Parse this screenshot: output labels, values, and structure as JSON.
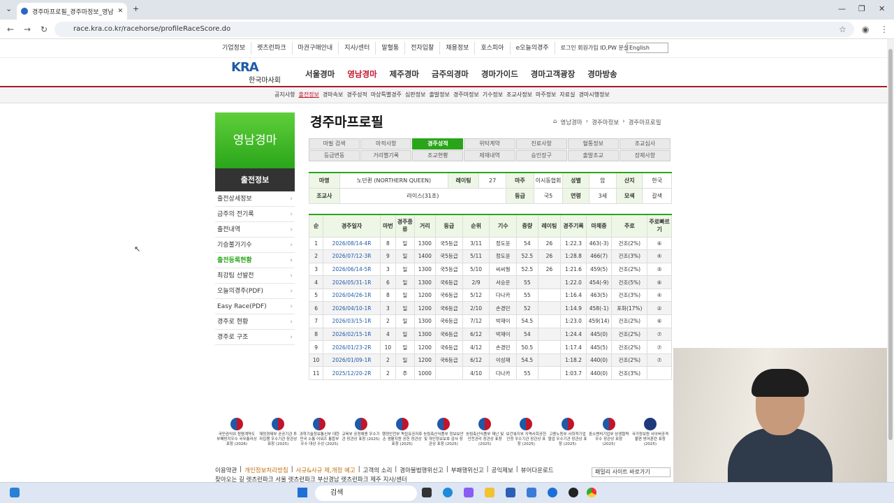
{
  "browser": {
    "tab_title": "경주마프로필_경주마정보_영남",
    "url": "race.kra.co.kr/racehorse/profileRaceScore.do"
  },
  "util_menu": [
    "기업정보",
    "렛츠런파크",
    "마권구매안내",
    "지사/센터",
    "말혈통",
    "전자입찰",
    "채용정보",
    "호스피아",
    "e오늘의경주",
    "로그인 회원가입 ID,PW 분실"
  ],
  "language": "English",
  "logo": {
    "mark": "KRA",
    "name": "한국마사회"
  },
  "gnb": [
    "서울경마",
    "영남경마",
    "제주경마",
    "금주의경마",
    "경마가이드",
    "경마고객광장",
    "경마방송"
  ],
  "subnav": [
    "공지사항",
    "출전정보",
    "경마속보",
    "경주성적",
    "마상특별경주",
    "심판정보",
    "출발정보",
    "경주마정보",
    "기수정보",
    "조교사정보",
    "마주정보",
    "자료실",
    "경마시행정보"
  ],
  "sidebar": {
    "banner": "영남경마",
    "title": "출전정보",
    "items": [
      "출전상세정보",
      "금주의 전기록",
      "출전내역",
      "기승불가기수",
      "출전등록현황",
      "최강팀 선발전",
      "오늘의경주(PDF)",
      "Easy Race(PDF)",
      "경주로 현황",
      "경주로 구조"
    ]
  },
  "page_title": "경주마프로필",
  "breadcrumb": [
    "영남경마",
    "경주마정보",
    "경주마프로필"
  ],
  "tabs": [
    "마필 검색",
    "마적사항",
    "경주성적",
    "위탁계약",
    "진료사항",
    "혈통정보",
    "조교심사",
    "등급변동",
    "거리별기록",
    "조교현황",
    "제재내역",
    "승인장구",
    "출발조교",
    "장제사항"
  ],
  "horse": {
    "labels": [
      "마명",
      "레이팅",
      "마주",
      "성별",
      "산지",
      "조교사",
      "등급",
      "연령",
      "모색"
    ],
    "name": "노던퀸 (NORTHERN QUEEN)",
    "rating": "27",
    "owner": "이시동협회",
    "sex": "암",
    "origin": "한국",
    "trainer": "라이스(31조)",
    "grade": "국5",
    "age": "3세",
    "color": "갈색"
  },
  "records": {
    "headers": [
      "순",
      "경주일자",
      "마번",
      "경주종류",
      "거리",
      "등급",
      "순위",
      "기수",
      "중량",
      "레이팅",
      "경주기록",
      "마체중",
      "주로",
      "주로빠르기"
    ],
    "rows": [
      [
        "1",
        "2026/08/14-4R",
        "8",
        "일",
        "1300",
        "국5등급",
        "3/11",
        "정도윤",
        "54",
        "26",
        "1:22.3",
        "463(-3)",
        "건조(2%)",
        "⑥"
      ],
      [
        "2",
        "2026/07/12-3R",
        "9",
        "일",
        "1400",
        "국5등급",
        "5/11",
        "정도윤",
        "52.5",
        "26",
        "1:28.8",
        "466(7)",
        "건조(3%)",
        "④"
      ],
      [
        "3",
        "2026/06/14-5R",
        "3",
        "일",
        "1300",
        "국5등급",
        "5/10",
        "씨씨웡",
        "52.5",
        "26",
        "1:21.6",
        "459(5)",
        "건조(2%)",
        "⑤"
      ],
      [
        "4",
        "2026/05/31-1R",
        "6",
        "일",
        "1300",
        "국6등급",
        "2/9",
        "서승운",
        "55",
        "",
        "1:22.0",
        "454(-9)",
        "건조(5%)",
        "⑥"
      ],
      [
        "5",
        "2026/04/26-1R",
        "8",
        "일",
        "1200",
        "국6등급",
        "5/12",
        "다나카",
        "55",
        "",
        "1:16.4",
        "463(5)",
        "건조(3%)",
        "④"
      ],
      [
        "6",
        "2026/04/10-1R",
        "3",
        "일",
        "1200",
        "국6등급",
        "2/10",
        "손경민",
        "52",
        "",
        "1:14.9",
        "458(-1)",
        "포화(17%)",
        "②"
      ],
      [
        "7",
        "2026/03/15-1R",
        "2",
        "일",
        "1300",
        "국6등급",
        "7/12",
        "박재이",
        "54.5",
        "",
        "1:23.0",
        "459(14)",
        "건조(2%)",
        "⑥"
      ],
      [
        "8",
        "2026/02/15-1R",
        "4",
        "일",
        "1300",
        "국6등급",
        "6/12",
        "박재이",
        "54",
        "",
        "1:24.4",
        "445(0)",
        "건조(2%)",
        "⑦"
      ],
      [
        "9",
        "2026/01/23-2R",
        "10",
        "일",
        "1200",
        "국6등급",
        "4/12",
        "손경민",
        "50.5",
        "",
        "1:17.4",
        "445(5)",
        "건조(2%)",
        "⑦"
      ],
      [
        "10",
        "2026/01/09-1R",
        "2",
        "일",
        "1200",
        "국6등급",
        "6/12",
        "이성재",
        "54.5",
        "",
        "1:18.2",
        "440(0)",
        "건조(2%)",
        "⑦"
      ],
      [
        "11",
        "2025/12/20-2R",
        "2",
        "주",
        "1000",
        "",
        "4/10",
        "다나카",
        "55",
        "",
        "1:03.7",
        "440(0)",
        "건조(3%)",
        ""
      ]
    ]
  },
  "footer_orgs": [
    "국민권익위 청렴계약도 부패방지우수 국무총리상 표창 (2026)",
    "재정경제부 공공기관 투자집행 우수기관 장관상 표창 (2025)",
    "과학기술정보통신부 대한민국 소통 어워즈 통합부 우수 대상 수상 (2025)",
    "교육부 공정채용 우수기관 장관상 표창 (2025)",
    "행정안전부 독립유공자후손 생활지원 공헌 장관상 표창 (2025)",
    "농림축산식품부 정보보안 및 개인정보보호 감사 장관상 표창 (2025)",
    "농림축산식품부 재난 및 안전관리 장관상 표창 (2025)",
    "보건복지부 지역사회공헌인정 우수기관 장관상 표창 (2025)",
    "고용노동부 사회적기업 협업 우수기관 장관상 표창 (2025)",
    "중소벤처기업부 상생협력 우수 장관상 표창 (2025)",
    "국가정보원 사이버공격 불편 방어훈련 표창 (2025)"
  ],
  "footer_links": [
    "이용약관",
    "개인정보처리방침",
    "사규&사규 제,개정 예고",
    "고객의 소리",
    "경마불법행위신고",
    "부패행위신고",
    "공익제보",
    "뷰어다운로드"
  ],
  "footer_line2": "찾아오는 길 렛츠런파크 서울 렛츠런파크 부산경남 렛츠런파크 제주 지사/센터",
  "family_site": "패밀리 사이트 바로가기",
  "taskbar": {
    "search": "검색"
  }
}
